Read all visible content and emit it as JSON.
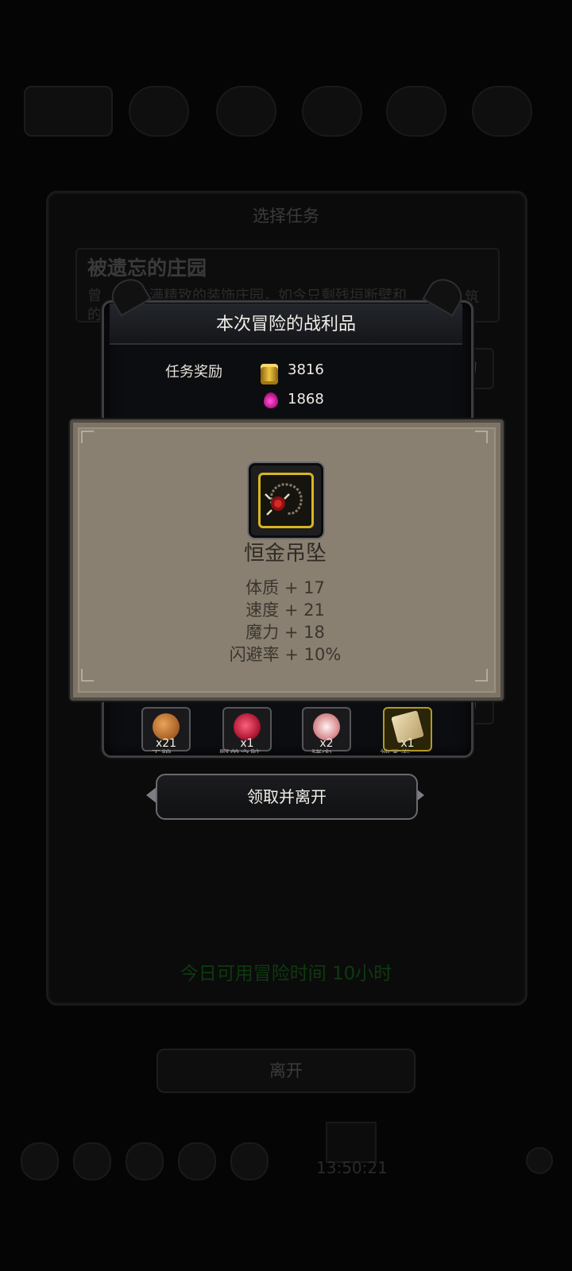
{
  "background": {
    "mission_window_title": "选择任务",
    "mission_name": "被遗忘的庄园",
    "mission_desc_fragments": [
      "曾",
      "满精致的装饰庄园，如今只剩残垣断壁和",
      "筑",
      "的"
    ],
    "side_tag": "约",
    "available_time": "今日可用冒险时间 10小时",
    "leave_button": "离开",
    "clock": "13:50:21"
  },
  "loot": {
    "title": "本次冒险的战利品",
    "reward_label": "任务奖励",
    "coins": "3816",
    "gems": "1868",
    "items": [
      {
        "count": "x21",
        "name": "干粮",
        "icon": "bread-icon",
        "color": "#c47a35"
      },
      {
        "count": "x1",
        "name": "野兽之脏",
        "icon": "heart-icon",
        "color": "#c2193c"
      },
      {
        "count": "x2",
        "name": "猪肉",
        "icon": "meat-icon",
        "color": "#e0a4a4"
      },
      {
        "count": "x1",
        "name": "神圣卷",
        "icon": "scroll-icon",
        "color": "#d8c69a"
      }
    ],
    "claim_button": "领取并离开"
  },
  "item_popup": {
    "name": "恒金吊坠",
    "icon": "pendant-icon",
    "stats": [
      "体质 + 17",
      "速度 + 21",
      "魔力 + 18",
      "闪避率 + 10%"
    ]
  },
  "colors": {
    "popup_bg": "#8a8071",
    "item_frame_gold": "#d8b61e",
    "time_text": "#0e3a10"
  }
}
